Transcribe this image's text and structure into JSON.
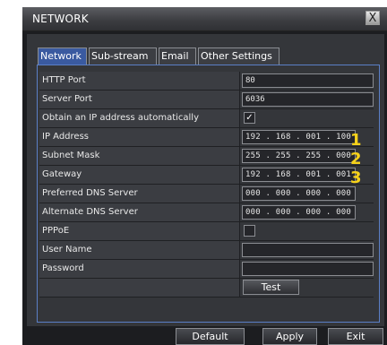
{
  "window": {
    "title": "NETWORK",
    "close_label": "X"
  },
  "tabs": [
    {
      "label": "Network",
      "active": true
    },
    {
      "label": "Sub-stream",
      "active": false
    },
    {
      "label": "Email",
      "active": false
    },
    {
      "label": "Other Settings",
      "active": false
    }
  ],
  "fields": {
    "http_port": {
      "label": "HTTP Port",
      "value": "80"
    },
    "server_port": {
      "label": "Server Port",
      "value": "6036"
    },
    "obtain_ip": {
      "label": "Obtain an IP address automatically",
      "checked": true,
      "mark": "✓"
    },
    "ip_address": {
      "label": "IP Address",
      "value": "192 . 168 . 001 . 100",
      "marker": "1"
    },
    "subnet_mask": {
      "label": "Subnet Mask",
      "value": "255 . 255 . 255 . 000",
      "marker": "2"
    },
    "gateway": {
      "label": "Gateway",
      "value": "192 . 168 . 001 . 001",
      "marker": "3"
    },
    "preferred_dns": {
      "label": "Preferred DNS Server",
      "value": "000 . 000 . 000 . 000"
    },
    "alternate_dns": {
      "label": "Alternate DNS Server",
      "value": "000 . 000 . 000 . 000"
    },
    "pppoe": {
      "label": "PPPoE",
      "checked": false
    },
    "user_name": {
      "label": "User Name",
      "value": ""
    },
    "password": {
      "label": "Password",
      "value": ""
    }
  },
  "buttons": {
    "test": "Test",
    "default": "Default",
    "apply": "Apply",
    "exit": "Exit"
  },
  "colors": {
    "active_tab": "#3a5aa0",
    "frame_border": "#5b7fc6",
    "marker": "#f6d21a"
  }
}
